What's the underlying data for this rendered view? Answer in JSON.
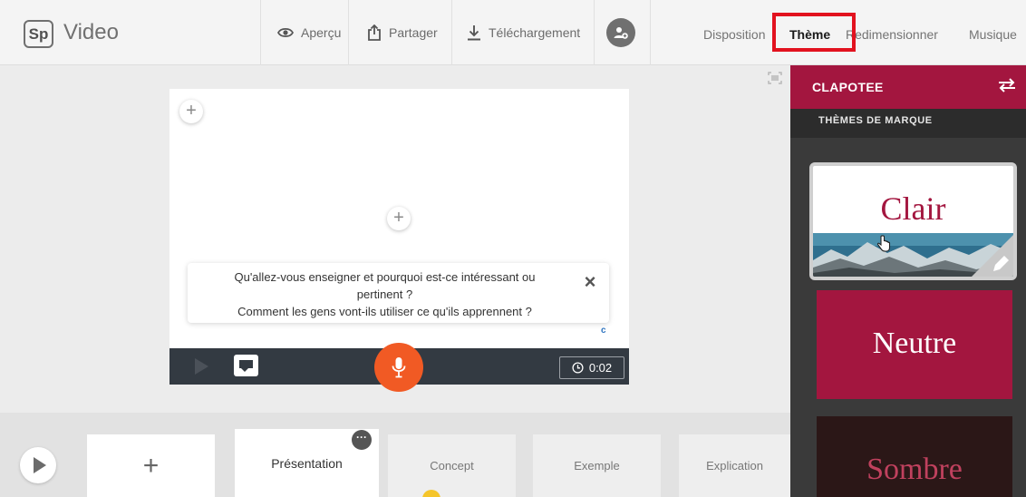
{
  "app": {
    "logo_text": "Sp",
    "title": "Video"
  },
  "toolbar": {
    "preview_label": "Aperçu",
    "share_label": "Partager",
    "download_label": "Téléchargement"
  },
  "nav_tabs": [
    {
      "label": "Disposition",
      "active": false
    },
    {
      "label": "Thème",
      "active": true
    },
    {
      "label": "Redimensionner",
      "active": false
    },
    {
      "label": "Musique",
      "active": false
    }
  ],
  "stage": {
    "prompt_line1": "Qu'allez-vous enseigner et pourquoi est-ce intéressant ou",
    "prompt_line2": "pertinent ?",
    "prompt_line3": "Comment les gens vont-ils utiliser ce qu'ils apprennent ?",
    "timer": "0:02"
  },
  "timeline": {
    "slides": [
      {
        "label": "Présentation",
        "selected": true
      },
      {
        "label": "Concept",
        "selected": false
      },
      {
        "label": "Exemple",
        "selected": false
      },
      {
        "label": "Explication",
        "selected": false
      }
    ]
  },
  "theme_panel": {
    "title": "CLAPOTEE",
    "subtitle": "THÈMES DE MARQUE",
    "themes": [
      {
        "name": "Clair",
        "selected": true
      },
      {
        "name": "Neutre",
        "selected": false
      },
      {
        "name": "Sombre",
        "selected": false
      }
    ]
  },
  "colors": {
    "accent": "#a3163f",
    "record": "#f15a24",
    "highlight": "#e2121f",
    "control_bar": "#333a42"
  }
}
